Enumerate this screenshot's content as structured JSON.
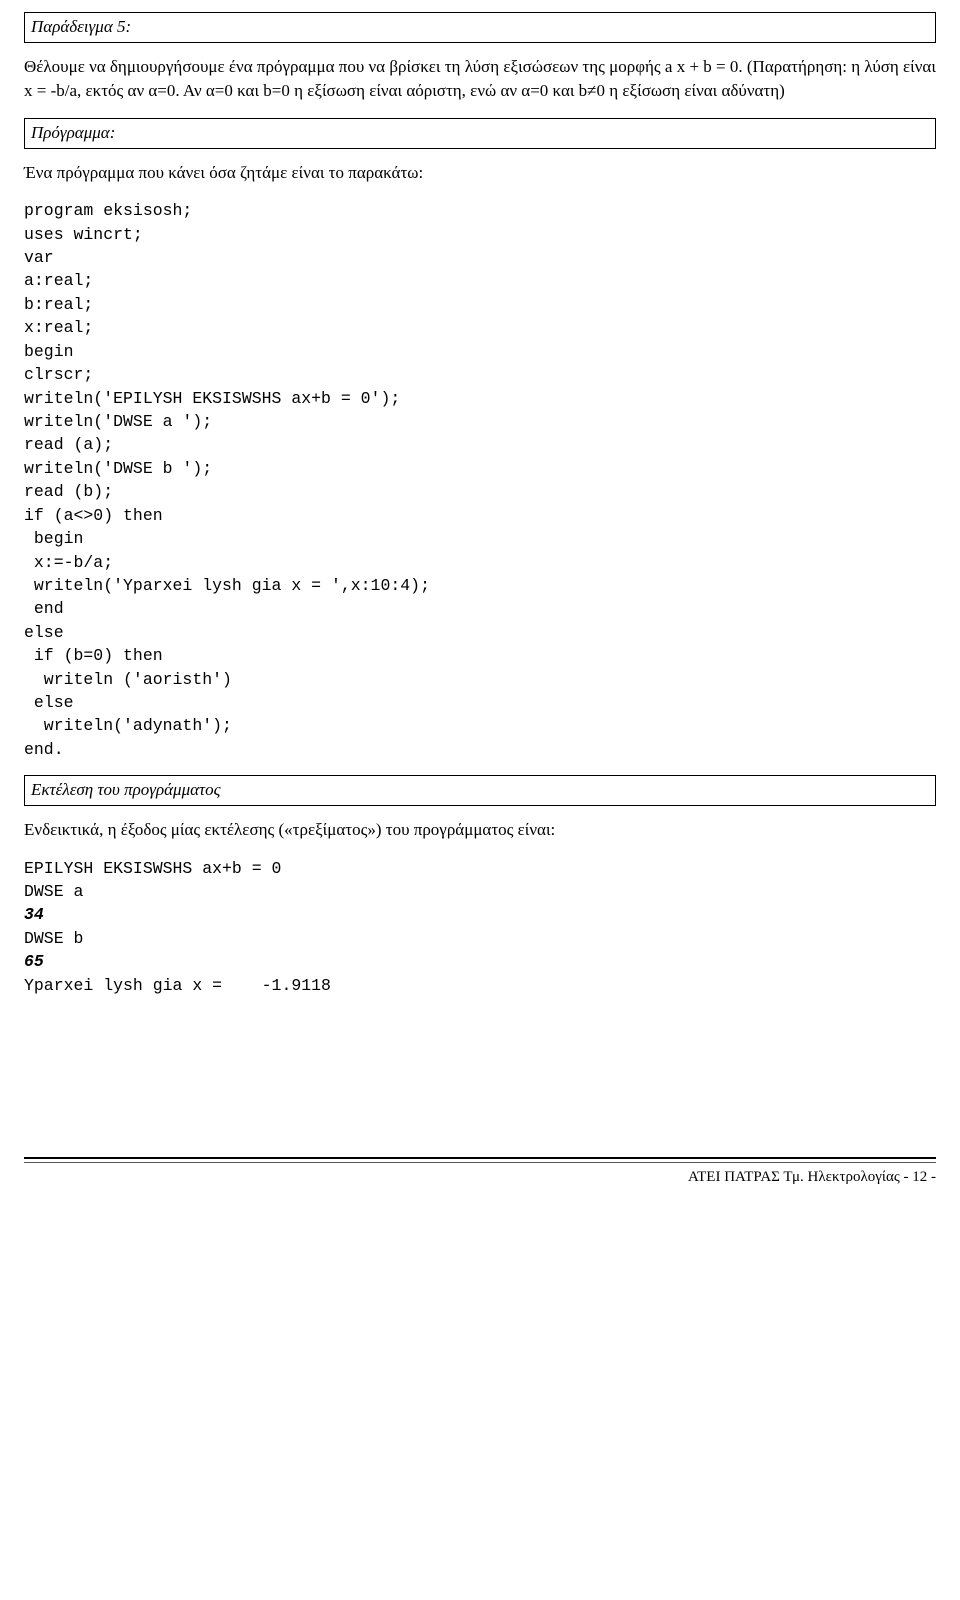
{
  "title": "Παράδειγμα 5:",
  "para1": "Θέλουμε να δημιουργήσουμε ένα πρόγραμμα που να βρίσκει τη λύση εξισώσεων της μορφής  a x + b = 0.  (Παρατήρηση: η λύση είναι x = -b/a, εκτός αν α=0. Αν α=0 και b=0 η εξίσωση είναι αόριστη, ενώ αν α=0 και b≠0 η εξίσωση είναι αδύνατη)",
  "subheading1": "Πρόγραμμα:",
  "para2": "Ένα πρόγραμμα που κάνει όσα ζητάμε είναι το παρακάτω:",
  "code": "program eksisosh;\nuses wincrt;\nvar\na:real;\nb:real;\nx:real;\nbegin\nclrscr;\nwriteln('EPILYSH EKSISWSHS ax+b = 0');\nwriteln('DWSE a ');\nread (a);\nwriteln('DWSE b ');\nread (b);\nif (a<>0) then\n begin\n x:=-b/a;\n writeln('Yparxei lysh gia x = ',x:10:4);\n end\nelse\n if (b=0) then\n  writeln ('aoristh')\n else\n  writeln('adynath');\nend.",
  "subheading2": "Εκτέλεση του προγράμματος",
  "para3": "Ενδεικτικά,  η έξοδος μίας εκτέλεσης («τρεξίματος») του προγράμματος είναι:",
  "output_line1": "EPILYSH EKSISWSHS ax+b = 0",
  "output_line2": "DWSE a",
  "output_input1": "34",
  "output_line3": "DWSE b",
  "output_input2": "65",
  "output_line4": "Yparxei lysh gia x =    -1.9118",
  "footer": "ΑΤΕΙ ΠΑΤΡΑΣ Τμ. Ηλεκτρολογίας - 12 -"
}
